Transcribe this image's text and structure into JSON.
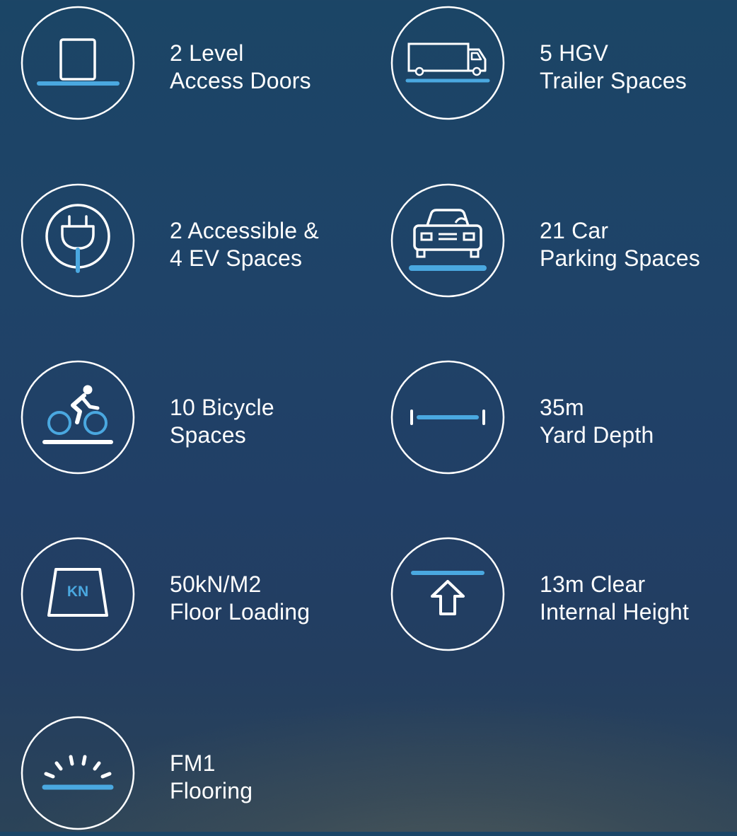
{
  "colors": {
    "accent": "#4aa8e0",
    "stroke": "#ffffff",
    "text": "#ffffff"
  },
  "features": [
    {
      "id": "level-access-doors",
      "icon": "door-icon",
      "line1": "2 Level",
      "line2": "Access Doors"
    },
    {
      "id": "hgv-trailer-spaces",
      "icon": "truck-icon",
      "line1": "5 HGV",
      "line2": "Trailer Spaces"
    },
    {
      "id": "accessible-ev-spaces",
      "icon": "ev-plug-icon",
      "line1": "2 Accessible &",
      "line2": "4 EV Spaces"
    },
    {
      "id": "car-parking-spaces",
      "icon": "car-icon",
      "line1": "21 Car",
      "line2": "Parking Spaces"
    },
    {
      "id": "bicycle-spaces",
      "icon": "bicycle-icon",
      "line1": "10 Bicycle",
      "line2": "Spaces"
    },
    {
      "id": "yard-depth",
      "icon": "depth-measure-icon",
      "line1": "35m",
      "line2": "Yard Depth"
    },
    {
      "id": "floor-loading",
      "icon": "weight-kn-icon",
      "line1": "50kN/M2",
      "line2": "Floor Loading",
      "icon_text": "KN"
    },
    {
      "id": "clear-internal-height",
      "icon": "height-arrow-icon",
      "line1": "13m Clear",
      "line2": "Internal Height"
    },
    {
      "id": "fm1-flooring",
      "icon": "shine-floor-icon",
      "line1": "FM1",
      "line2": "Flooring"
    }
  ]
}
